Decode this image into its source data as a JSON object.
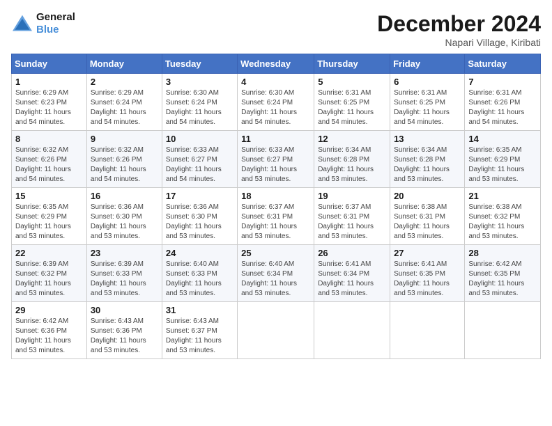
{
  "header": {
    "logo_line1": "General",
    "logo_line2": "Blue",
    "main_title": "December 2024",
    "subtitle": "Napari Village, Kiribati"
  },
  "calendar": {
    "days_of_week": [
      "Sunday",
      "Monday",
      "Tuesday",
      "Wednesday",
      "Thursday",
      "Friday",
      "Saturday"
    ],
    "weeks": [
      [
        {
          "day": "1",
          "sunrise": "6:29 AM",
          "sunset": "6:23 PM",
          "daylight": "11 hours and 54 minutes."
        },
        {
          "day": "2",
          "sunrise": "6:29 AM",
          "sunset": "6:24 PM",
          "daylight": "11 hours and 54 minutes."
        },
        {
          "day": "3",
          "sunrise": "6:30 AM",
          "sunset": "6:24 PM",
          "daylight": "11 hours and 54 minutes."
        },
        {
          "day": "4",
          "sunrise": "6:30 AM",
          "sunset": "6:24 PM",
          "daylight": "11 hours and 54 minutes."
        },
        {
          "day": "5",
          "sunrise": "6:31 AM",
          "sunset": "6:25 PM",
          "daylight": "11 hours and 54 minutes."
        },
        {
          "day": "6",
          "sunrise": "6:31 AM",
          "sunset": "6:25 PM",
          "daylight": "11 hours and 54 minutes."
        },
        {
          "day": "7",
          "sunrise": "6:31 AM",
          "sunset": "6:26 PM",
          "daylight": "11 hours and 54 minutes."
        }
      ],
      [
        {
          "day": "8",
          "sunrise": "6:32 AM",
          "sunset": "6:26 PM",
          "daylight": "11 hours and 54 minutes."
        },
        {
          "day": "9",
          "sunrise": "6:32 AM",
          "sunset": "6:26 PM",
          "daylight": "11 hours and 54 minutes."
        },
        {
          "day": "10",
          "sunrise": "6:33 AM",
          "sunset": "6:27 PM",
          "daylight": "11 hours and 54 minutes."
        },
        {
          "day": "11",
          "sunrise": "6:33 AM",
          "sunset": "6:27 PM",
          "daylight": "11 hours and 53 minutes."
        },
        {
          "day": "12",
          "sunrise": "6:34 AM",
          "sunset": "6:28 PM",
          "daylight": "11 hours and 53 minutes."
        },
        {
          "day": "13",
          "sunrise": "6:34 AM",
          "sunset": "6:28 PM",
          "daylight": "11 hours and 53 minutes."
        },
        {
          "day": "14",
          "sunrise": "6:35 AM",
          "sunset": "6:29 PM",
          "daylight": "11 hours and 53 minutes."
        }
      ],
      [
        {
          "day": "15",
          "sunrise": "6:35 AM",
          "sunset": "6:29 PM",
          "daylight": "11 hours and 53 minutes."
        },
        {
          "day": "16",
          "sunrise": "6:36 AM",
          "sunset": "6:30 PM",
          "daylight": "11 hours and 53 minutes."
        },
        {
          "day": "17",
          "sunrise": "6:36 AM",
          "sunset": "6:30 PM",
          "daylight": "11 hours and 53 minutes."
        },
        {
          "day": "18",
          "sunrise": "6:37 AM",
          "sunset": "6:31 PM",
          "daylight": "11 hours and 53 minutes."
        },
        {
          "day": "19",
          "sunrise": "6:37 AM",
          "sunset": "6:31 PM",
          "daylight": "11 hours and 53 minutes."
        },
        {
          "day": "20",
          "sunrise": "6:38 AM",
          "sunset": "6:31 PM",
          "daylight": "11 hours and 53 minutes."
        },
        {
          "day": "21",
          "sunrise": "6:38 AM",
          "sunset": "6:32 PM",
          "daylight": "11 hours and 53 minutes."
        }
      ],
      [
        {
          "day": "22",
          "sunrise": "6:39 AM",
          "sunset": "6:32 PM",
          "daylight": "11 hours and 53 minutes."
        },
        {
          "day": "23",
          "sunrise": "6:39 AM",
          "sunset": "6:33 PM",
          "daylight": "11 hours and 53 minutes."
        },
        {
          "day": "24",
          "sunrise": "6:40 AM",
          "sunset": "6:33 PM",
          "daylight": "11 hours and 53 minutes."
        },
        {
          "day": "25",
          "sunrise": "6:40 AM",
          "sunset": "6:34 PM",
          "daylight": "11 hours and 53 minutes."
        },
        {
          "day": "26",
          "sunrise": "6:41 AM",
          "sunset": "6:34 PM",
          "daylight": "11 hours and 53 minutes."
        },
        {
          "day": "27",
          "sunrise": "6:41 AM",
          "sunset": "6:35 PM",
          "daylight": "11 hours and 53 minutes."
        },
        {
          "day": "28",
          "sunrise": "6:42 AM",
          "sunset": "6:35 PM",
          "daylight": "11 hours and 53 minutes."
        }
      ],
      [
        {
          "day": "29",
          "sunrise": "6:42 AM",
          "sunset": "6:36 PM",
          "daylight": "11 hours and 53 minutes."
        },
        {
          "day": "30",
          "sunrise": "6:43 AM",
          "sunset": "6:36 PM",
          "daylight": "11 hours and 53 minutes."
        },
        {
          "day": "31",
          "sunrise": "6:43 AM",
          "sunset": "6:37 PM",
          "daylight": "11 hours and 53 minutes."
        },
        null,
        null,
        null,
        null
      ]
    ]
  }
}
